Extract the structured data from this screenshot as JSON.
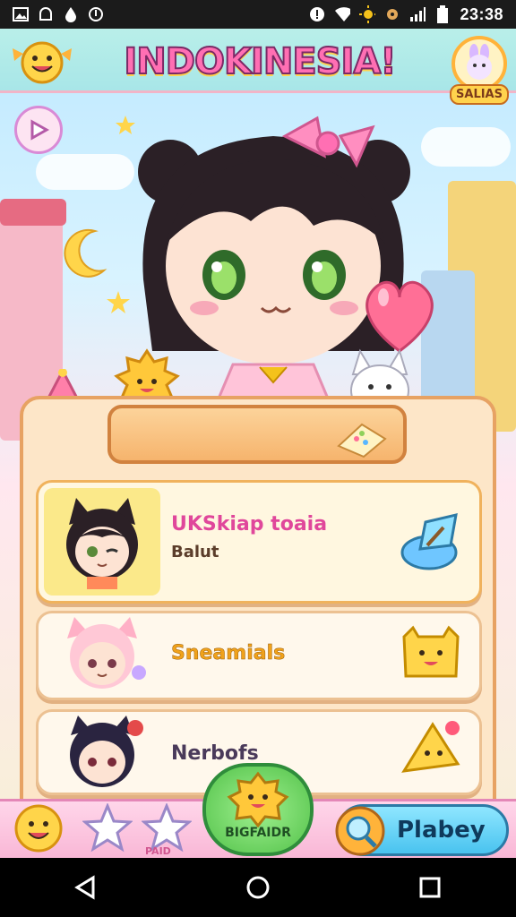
{
  "status_bar": {
    "time": "23:38",
    "left_icons": [
      "gallery-icon",
      "notification-icon",
      "drop-icon",
      "sync-icon"
    ],
    "right_icons": [
      "alert-icon",
      "wifi-icon",
      "sun-icon",
      "settings-icon",
      "signal-icon",
      "battery-icon"
    ]
  },
  "header": {
    "title": "INDOKINESIA!",
    "badge_label": "SALIAS"
  },
  "cards": [
    {
      "name": "UKSkiap toaia",
      "subtitle": "Balut",
      "selected": true
    },
    {
      "name": "Sneamials",
      "subtitle": ""
    },
    {
      "name": "Nerbofs",
      "subtitle": ""
    }
  ],
  "bottom_nav": {
    "center_label": "BIGFAIDR",
    "small_label": "PAID",
    "play_label": "Plabey"
  },
  "colors": {
    "accent_pink": "#ff6fb3",
    "panel": "#fde6c8",
    "play_blue": "#49c3ef",
    "center_green": "#53c24a"
  }
}
